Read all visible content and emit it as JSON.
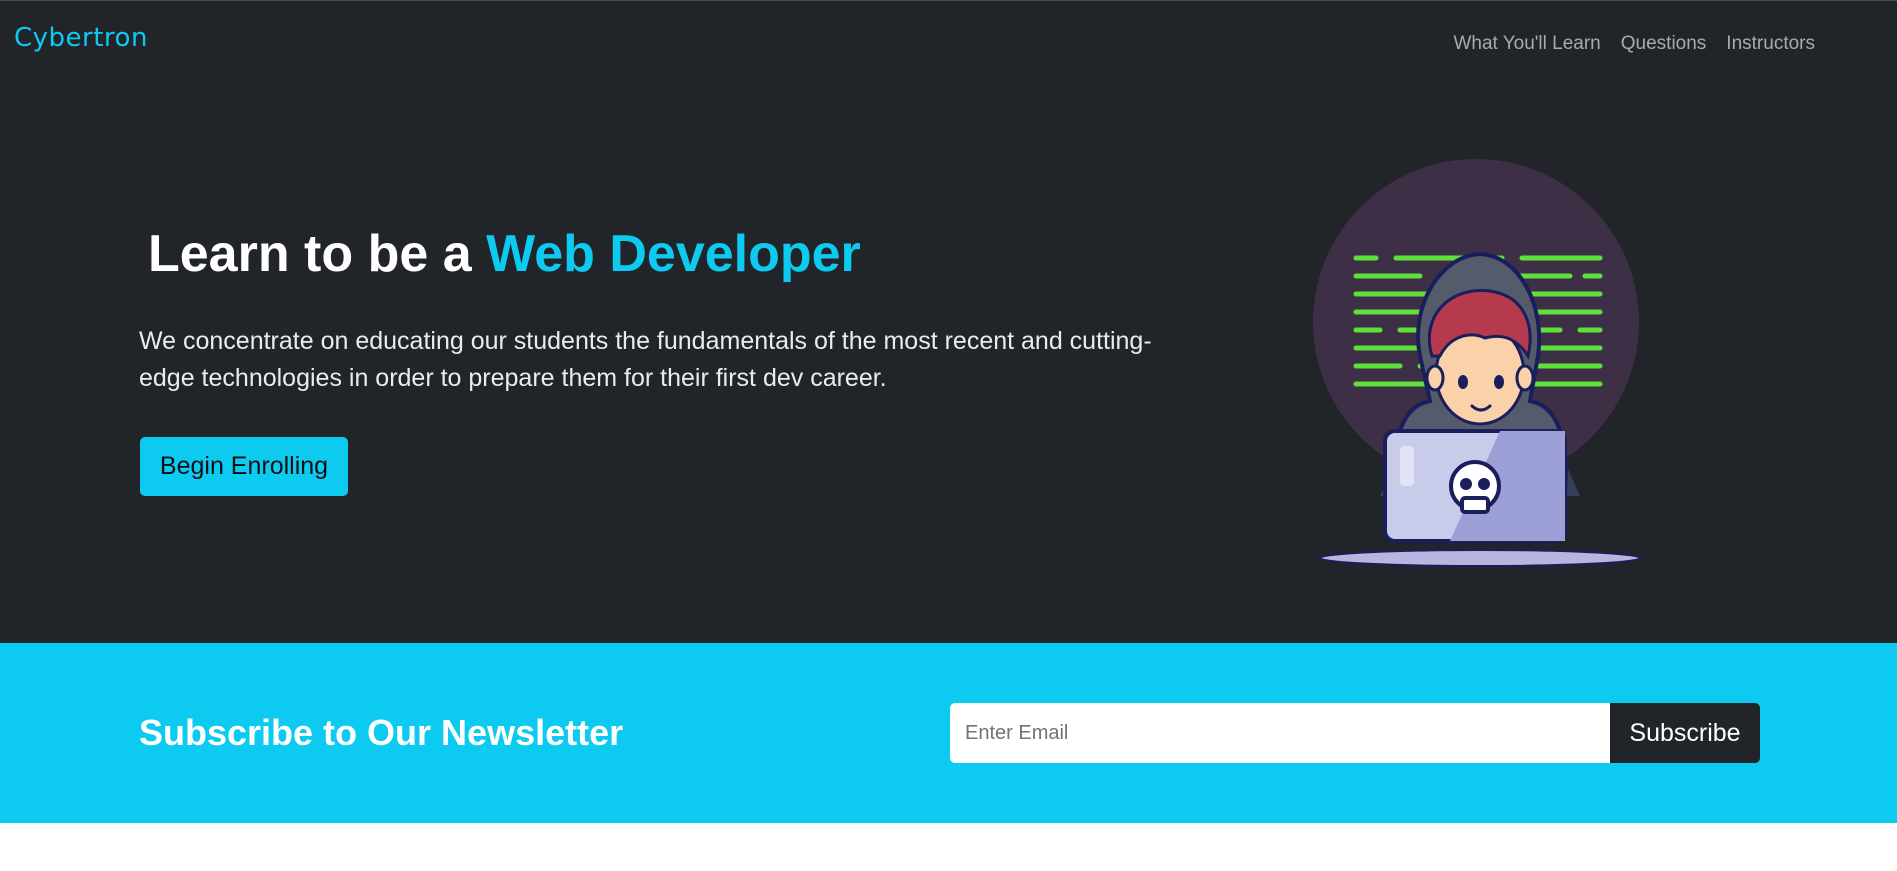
{
  "navbar": {
    "brand": "Cybertron",
    "links": [
      {
        "label": "What You'll Learn"
      },
      {
        "label": "Questions"
      },
      {
        "label": "Instructors"
      }
    ]
  },
  "hero": {
    "title_prefix": "Learn to be a ",
    "title_accent": "Web Developer",
    "description": "We concentrate on educating our students the fundamentals of the most recent and cutting-edge technologies in order to prepare them for their first dev career.",
    "cta_label": "Begin Enrolling",
    "illustration_icon": "hacker-laptop-illustration"
  },
  "newsletter": {
    "title": "Subscribe to Our Newsletter",
    "email_placeholder": "Enter Email",
    "email_value": "",
    "subscribe_label": "Subscribe"
  },
  "colors": {
    "dark_bg": "#212529",
    "accent": "#0dcaf0",
    "nav_text": "#a7abb0",
    "white": "#ffffff"
  }
}
